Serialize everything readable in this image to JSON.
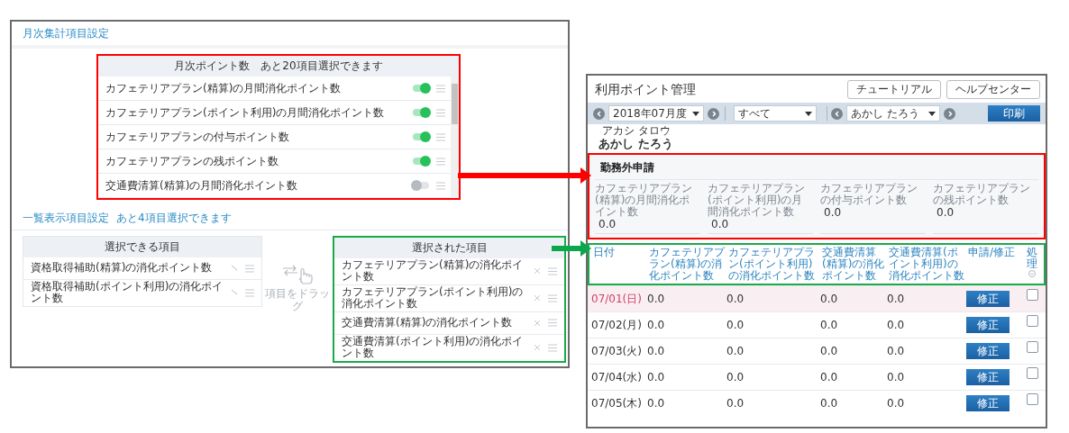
{
  "monthly_settings": {
    "title": "月次集計項目設定",
    "list": {
      "header": "月次ポイント数　あと20項目選択できます",
      "items": [
        {
          "label": "カフェテリアプラン(精算)の月間消化ポイント数",
          "on": true
        },
        {
          "label": "カフェテリアプラン(ポイント利用)の月間消化ポイント数",
          "on": true
        },
        {
          "label": "カフェテリアプランの付与ポイント数",
          "on": true
        },
        {
          "label": "カフェテリアプランの残ポイント数",
          "on": true
        },
        {
          "label": "交通費清算(精算)の月間消化ポイント数",
          "on": false
        }
      ]
    }
  },
  "list_display_settings": {
    "title": "一覧表示項目設定",
    "note": "あと4項目選択できます",
    "available": {
      "header": "選択できる項目",
      "items": [
        "資格取得補助(精算)の消化ポイント数",
        "資格取得補助(ポイント利用)の消化ポイント数"
      ]
    },
    "drag_hint": "項目をドラッグ",
    "selected": {
      "header": "選択された項目",
      "items": [
        "カフェテリアプラン(精算)の消化ポイント数",
        "カフェテリアプラン(ポイント利用)の消化ポイント数",
        "交通費清算(精算)の消化ポイント数",
        "交通費清算(ポイント利用)の消化ポイント数"
      ]
    }
  },
  "point_management": {
    "title": "利用ポイント管理",
    "buttons": [
      "チュートリアル",
      "ヘルプセンター"
    ],
    "toolbar": {
      "period": "2018年07月度",
      "filter": "すべて",
      "employee": "あかし たろう",
      "print": "印刷"
    },
    "name_ruby": "アカシ タロウ",
    "name": "あかし たろう",
    "summary": {
      "title": "勤務外申請",
      "fields": [
        {
          "label": "カフェテリアプラン(精算)の月間消化ポイント数",
          "value": "0.0"
        },
        {
          "label": "カフェテリアプラン(ポイント利用)の月間消化ポイント数",
          "value": "0.0"
        },
        {
          "label": "カフェテリアプランの付与ポイント数",
          "value": "0.0"
        },
        {
          "label": "カフェテリアプランの残ポイント数",
          "value": "0.0"
        }
      ]
    },
    "table": {
      "columns": [
        "日付",
        "カフェテリアプラン(精算)の消化ポイント数",
        "カフェテリアプラン(ポイント利用)の消化ポイント数",
        "交通費清算(精算)の消化ポイント数",
        "交通費清算(ポイント利用)の消化ポイント数",
        "申請/修正",
        "処理"
      ],
      "rows": [
        {
          "holiday": true,
          "cells": [
            "07/01(日)",
            "0.0",
            "0.0",
            "0.0",
            "0.0",
            "修正"
          ],
          "checked": false
        },
        {
          "holiday": false,
          "cells": [
            "07/02(月)",
            "0.0",
            "0.0",
            "0.0",
            "0.0",
            "修正"
          ],
          "checked": false
        },
        {
          "holiday": false,
          "cells": [
            "07/03(火)",
            "0.0",
            "0.0",
            "0.0",
            "0.0",
            "修正"
          ],
          "checked": false
        },
        {
          "holiday": false,
          "cells": [
            "07/04(水)",
            "0.0",
            "0.0",
            "0.0",
            "0.0",
            "修正"
          ],
          "checked": false
        },
        {
          "holiday": false,
          "cells": [
            "07/05(木)",
            "0.0",
            "0.0",
            "0.0",
            "0.0",
            "修正"
          ],
          "checked": false
        }
      ]
    }
  }
}
